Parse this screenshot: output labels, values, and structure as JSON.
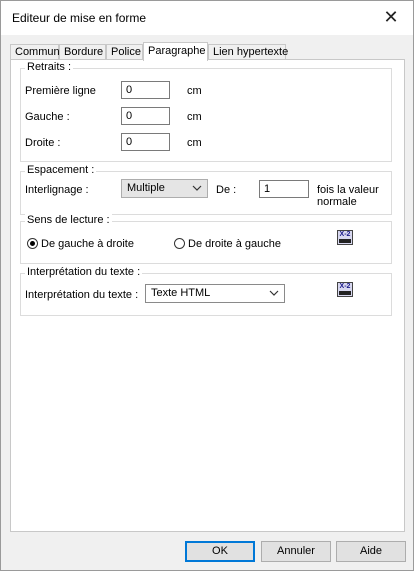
{
  "window": {
    "title": "Editeur de mise en forme"
  },
  "tabs": [
    {
      "label": "Commun"
    },
    {
      "label": "Bordure"
    },
    {
      "label": "Police"
    },
    {
      "label": "Paragraphe"
    },
    {
      "label": "Lien hypertexte"
    }
  ],
  "active_tab": "Paragraphe",
  "retraits": {
    "legend": "Retraits :",
    "premiere_ligne": {
      "label": "Première ligne",
      "value": "0",
      "unit": "cm"
    },
    "gauche": {
      "label": "Gauche :",
      "value": "0",
      "unit": "cm"
    },
    "droite": {
      "label": "Droite :",
      "value": "0",
      "unit": "cm"
    }
  },
  "espacement": {
    "legend": "Espacement :",
    "interlignage_label": "Interlignage :",
    "interlignage_value": "Multiple",
    "de_label": "De :",
    "de_value": "1",
    "suffix_line1": "fois la valeur",
    "suffix_line2": "normale"
  },
  "sens": {
    "legend": "Sens de lecture :",
    "option1": "De gauche à droite",
    "option2": "De droite à gauche",
    "selected": "De gauche à droite"
  },
  "interpretation": {
    "legend": "Interprétation du texte :",
    "label": "Interprétation du texte :",
    "value": "Texte HTML"
  },
  "help_icon_text": "X-2",
  "buttons": {
    "ok": "OK",
    "cancel": "Annuler",
    "help": "Aide"
  }
}
